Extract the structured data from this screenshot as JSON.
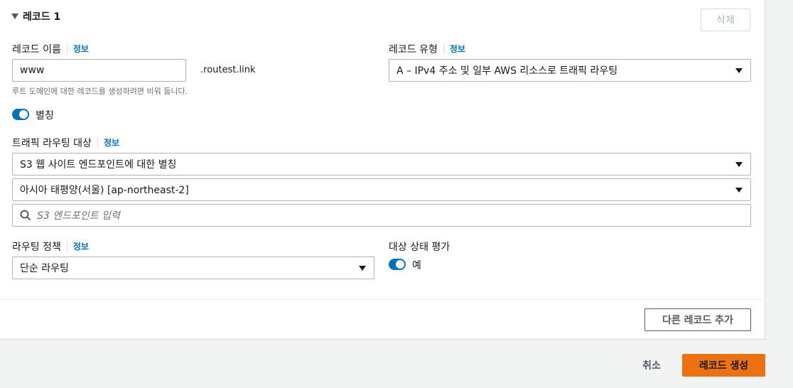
{
  "record": {
    "section_title": "레코드 1",
    "delete_label": "삭제",
    "name_label": "레코드 이름",
    "info_label": "정보",
    "name_value": "www",
    "domain_suffix": ".routest.link",
    "name_hint": "루트 도메인에 대한 레코드를 생성하려면 비워 둡니다.",
    "type_label": "레코드 유형",
    "type_value": "A – IPv4 주소 및 일부 AWS 리소스로 트래픽 라우팅",
    "alias_label": "별칭",
    "alias_enabled": true,
    "target_label": "트래픽 라우팅 대상",
    "endpoint_type_value": "S3 웹 사이트 엔드포인트에 대한 별칭",
    "region_value": "아시아 태평양(서울) [ap-northeast-2]",
    "endpoint_placeholder": "S3 엔드포인트 입력",
    "policy_label": "라우팅 정책",
    "policy_value": "단순 라우팅",
    "health_label": "대상 상태 평가",
    "health_value": "예",
    "health_enabled": true
  },
  "footer": {
    "add_record_label": "다른 레코드 추가",
    "cancel_label": "취소",
    "create_label": "레코드 생성"
  },
  "colors": {
    "accent": "#0073bb",
    "primary_button": "#ec7211"
  },
  "icons": [
    "collapse-triangle-icon",
    "dropdown-caret-icon",
    "search-icon"
  ]
}
